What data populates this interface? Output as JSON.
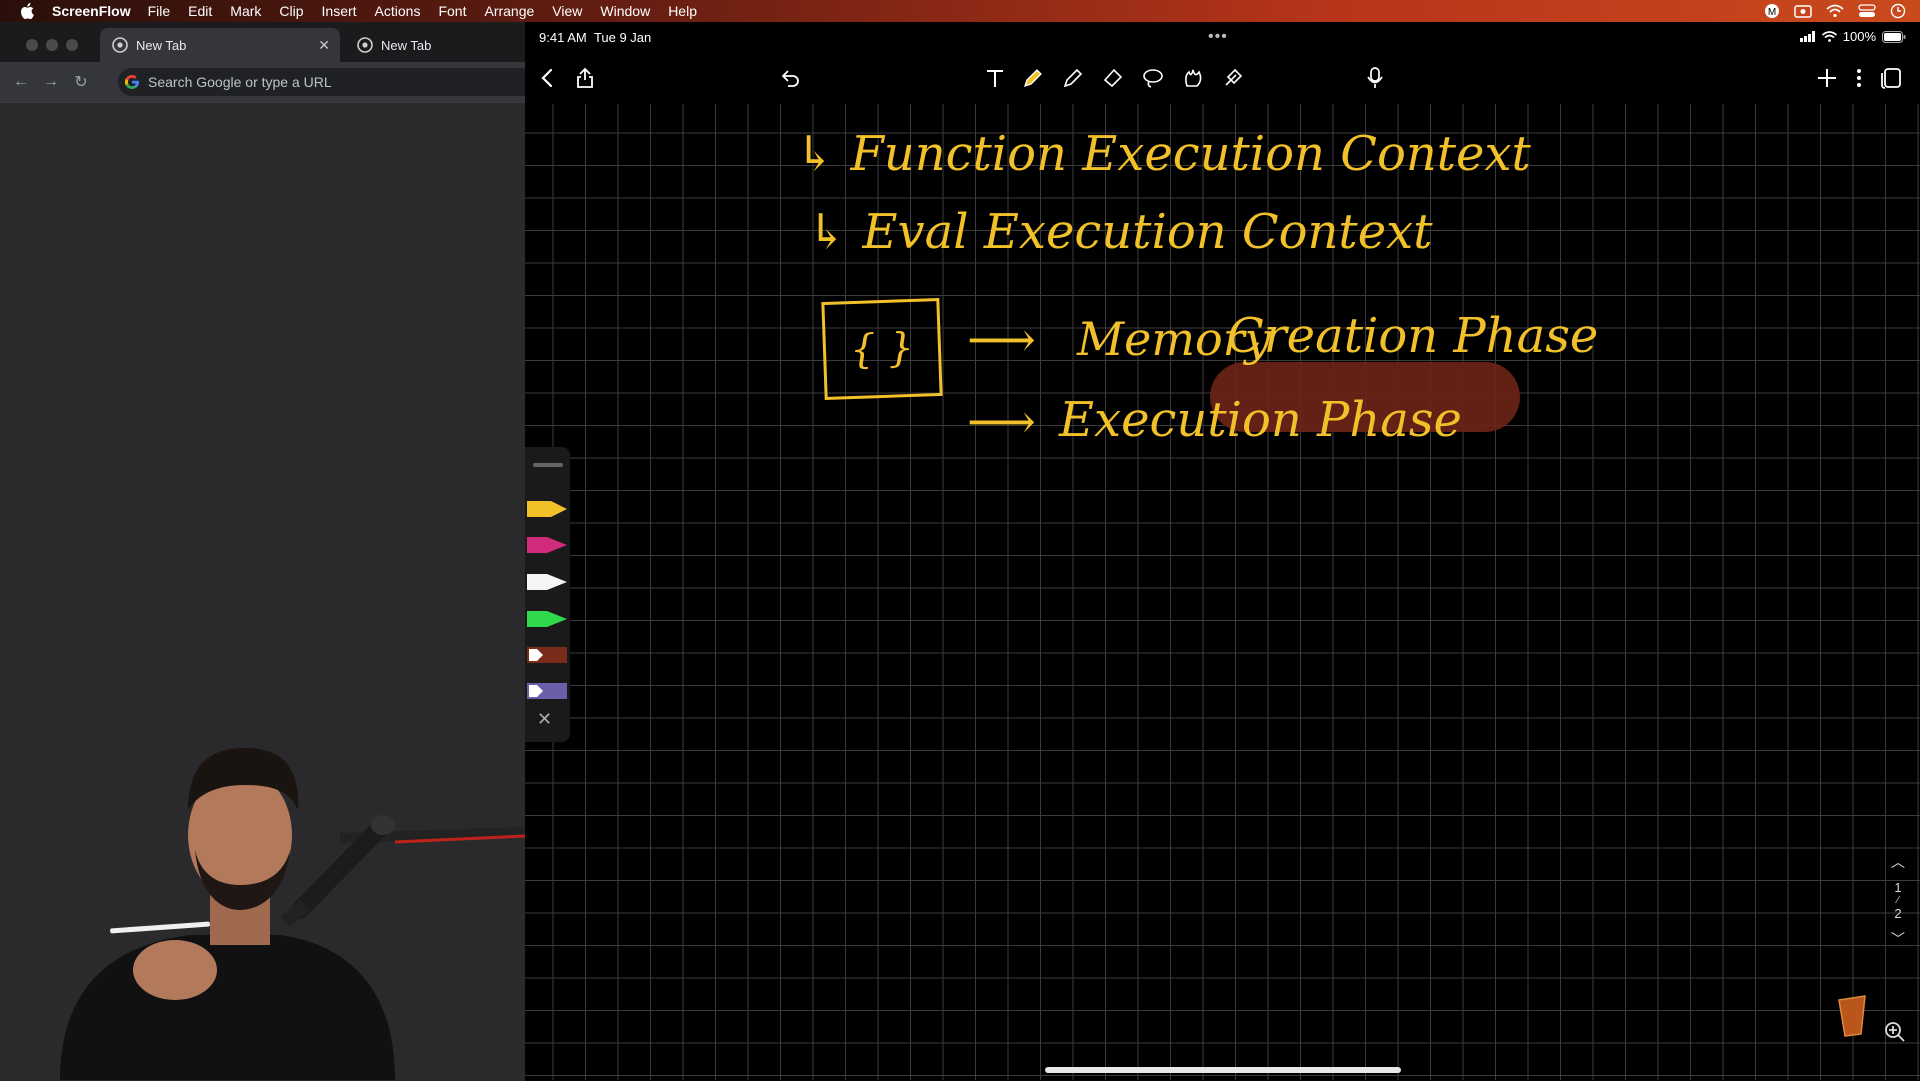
{
  "menubar": {
    "app_name": "ScreenFlow",
    "items": [
      "File",
      "Edit",
      "Mark",
      "Clip",
      "Insert",
      "Actions",
      "Font",
      "Arrange",
      "View",
      "Window",
      "Help"
    ]
  },
  "browser": {
    "tabs": [
      {
        "label": "New Tab",
        "active": true
      },
      {
        "label": "New Tab",
        "active": false
      }
    ],
    "omnibox_placeholder": "Search Google or type a URL"
  },
  "ipad": {
    "status": {
      "time": "9:41 AM",
      "date": "Tue 9 Jan",
      "battery": "100%"
    },
    "toolbar_icons": [
      "back-icon",
      "share-icon",
      "undo-icon",
      "text-tool-icon",
      "pen-tool-icon",
      "highlighter-tool-icon",
      "eraser-tool-icon",
      "lasso-tool-icon",
      "shapes-tool-icon",
      "hand-tool-icon",
      "microphone-icon",
      "add-page-icon",
      "more-options-icon",
      "page-thumbnails-icon"
    ],
    "notes": {
      "line1": "↳ Function Execution Context",
      "line2": "↳ Eval Execution Context",
      "box": "{ }",
      "arrow": "⟶",
      "memory": "Memory",
      "creation": "Creation Phase",
      "execution": "Execution Phase"
    },
    "pen_colors": [
      "#f2c12a",
      "#d12b7c",
      "#f5f5f5",
      "#2fd94b",
      "#7a2b1c",
      "#6a5fa8"
    ],
    "pages": {
      "current": "1",
      "total": "2"
    },
    "ink_color": "#f2c12a",
    "highlight_color": "#6e2316"
  }
}
